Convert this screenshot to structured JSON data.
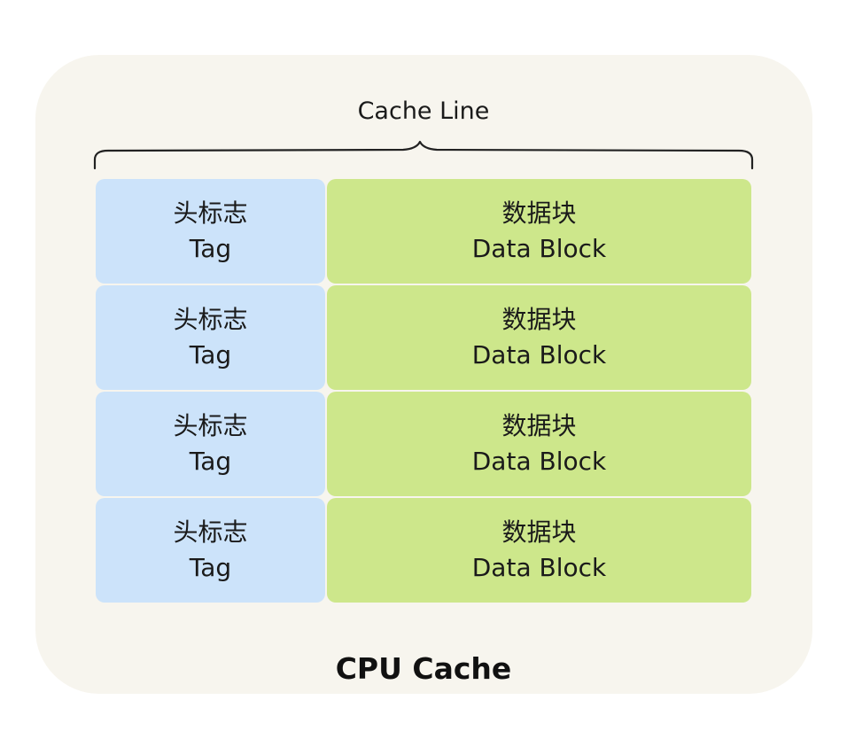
{
  "diagram": {
    "top_label": "Cache Line",
    "footer_title": "CPU Cache",
    "rows": [
      {
        "tag_cn": "头标志",
        "tag_en": "Tag",
        "data_cn": "数据块",
        "data_en": "Data Block"
      },
      {
        "tag_cn": "头标志",
        "tag_en": "Tag",
        "data_cn": "数据块",
        "data_en": "Data Block"
      },
      {
        "tag_cn": "头标志",
        "tag_en": "Tag",
        "data_cn": "数据块",
        "data_en": "Data Block"
      },
      {
        "tag_cn": "头标志",
        "tag_en": "Tag",
        "data_cn": "数据块",
        "data_en": "Data Block"
      }
    ],
    "colors": {
      "panel_background": "#f7f5ee",
      "tag_fill": "#cce3fa",
      "data_fill": "#cde78b",
      "text": "#1a1a1a"
    }
  }
}
